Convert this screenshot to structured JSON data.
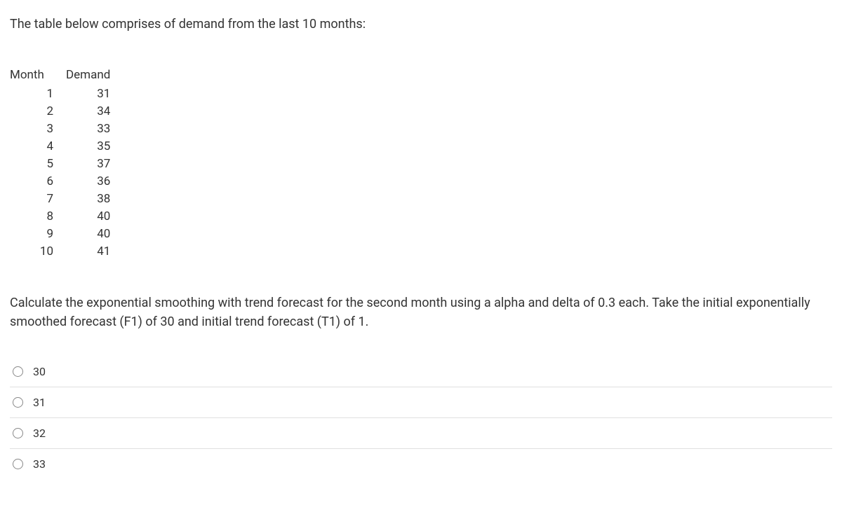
{
  "intro": "The table below comprises of demand from the last 10 months:",
  "table": {
    "headers": {
      "month": "Month",
      "demand": "Demand"
    },
    "rows": [
      {
        "month": "1",
        "demand": "31"
      },
      {
        "month": "2",
        "demand": "34"
      },
      {
        "month": "3",
        "demand": "33"
      },
      {
        "month": "4",
        "demand": "35"
      },
      {
        "month": "5",
        "demand": "37"
      },
      {
        "month": "6",
        "demand": "36"
      },
      {
        "month": "7",
        "demand": "38"
      },
      {
        "month": "8",
        "demand": "40"
      },
      {
        "month": "9",
        "demand": "40"
      },
      {
        "month": "10",
        "demand": "41"
      }
    ]
  },
  "question": "Calculate the exponential smoothing with trend forecast for the second month using a alpha and delta of 0.3 each. Take the initial exponentially smoothed forecast (F1) of 30 and initial trend forecast (T1) of 1.",
  "options": [
    {
      "label": "30"
    },
    {
      "label": "31"
    },
    {
      "label": "32"
    },
    {
      "label": "33"
    }
  ]
}
